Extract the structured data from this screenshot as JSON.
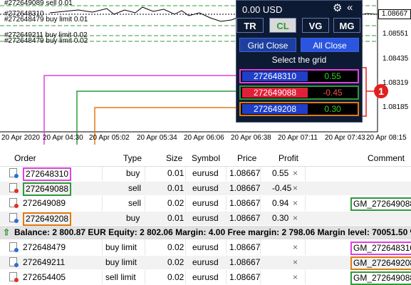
{
  "chart": {
    "current_price": "1.08667",
    "y_ticks": [
      "1.08551",
      "1.08435",
      "1.08319",
      "1.08185"
    ],
    "x_ticks": [
      "20 Apr 2020",
      "20 Apr 04:30",
      "20 Apr 05:02",
      "20 Apr 05:34",
      "20 Apr 06:06",
      "20 Apr 06:38",
      "20 Apr 07:11",
      "20 Apr 07:43",
      "20 Apr 08:15"
    ],
    "line_labels": [
      "#272649089 sell 0.01",
      "#272648479 buy limit 0.01",
      "#272649211 buy limit 0.02",
      "#272648479 buy limit 0.02"
    ],
    "line_label_top": "#272648310"
  },
  "panel": {
    "balance": "0.00 USD",
    "gear_icon": "gear-icon",
    "collapse_icon": "double-chevron-left-icon",
    "tabs": [
      "TR",
      "CL",
      "VG",
      "MG"
    ],
    "active_tab": "CL",
    "buttons": [
      "Grid Close",
      "All Close"
    ],
    "select_label": "Select the grid",
    "grids": [
      {
        "id": "272648310",
        "profit": "0.55",
        "border": "#e040e0",
        "bg": "#1f3fc9",
        "profit_color": "#2fd02f"
      },
      {
        "id": "272649088",
        "profit": "-0.45",
        "border": "#2e9a3a",
        "bg": "#e0203a",
        "profit_color": "#f24848"
      },
      {
        "id": "272649208",
        "profit": "0.30",
        "border": "#e07a10",
        "bg": "#1f3fc9",
        "profit_color": "#2fd02f"
      }
    ]
  },
  "callout": {
    "number": "1",
    "color": "#e0201d"
  },
  "table": {
    "headers": {
      "order": "Order",
      "type": "Type",
      "size": "Size",
      "symbol": "Symbol",
      "price": "Price",
      "profit": "Profit",
      "comment": "Comment"
    },
    "rows": [
      {
        "order": "272648310",
        "type": "buy",
        "size": "0.01",
        "symbol": "eurusd",
        "price": "1.08667",
        "profit": "0.55",
        "comment": "",
        "order_box": "#e040e0",
        "comment_box": "",
        "dot": "#2a6fd6"
      },
      {
        "order": "272649088",
        "type": "sell",
        "size": "0.01",
        "symbol": "eurusd",
        "price": "1.08667",
        "profit": "-0.45",
        "comment": "",
        "order_box": "#2e9a3a",
        "comment_box": "",
        "dot": "#e0301d"
      },
      {
        "order": "272649089",
        "type": "sell",
        "size": "0.02",
        "symbol": "eurusd",
        "price": "1.08667",
        "profit": "0.94",
        "comment": "GM_272649088",
        "order_box": "",
        "comment_box": "#2e9a3a",
        "dot": "#e0301d"
      },
      {
        "order": "272649208",
        "type": "buy",
        "size": "0.01",
        "symbol": "eurusd",
        "price": "1.08667",
        "profit": "0.30",
        "comment": "",
        "order_box": "#e07a10",
        "comment_box": "",
        "dot": "#2a6fd6"
      }
    ],
    "summary": "Balance: 2 800.87 EUR  Equity: 2 802.06  Margin: 4.00  Free margin: 2 798.06  Margin level: 70051.50 %",
    "pending": [
      {
        "order": "272648479",
        "type": "buy limit",
        "size": "0.02",
        "symbol": "eurusd",
        "price": "1.08667",
        "comment": "GM_272648310",
        "comment_box": "#e040e0",
        "dot": "#2a6fd6"
      },
      {
        "order": "272649211",
        "type": "buy limit",
        "size": "0.02",
        "symbol": "eurusd",
        "price": "1.08667",
        "comment": "GM_272649208",
        "comment_box": "#e07a10",
        "dot": "#2a6fd6"
      },
      {
        "order": "272654405",
        "type": "sell limit",
        "size": "0.02",
        "symbol": "eurusd",
        "price": "1.08667",
        "comment": "GM_272649088",
        "comment_box": "#2e9a3a",
        "dot": "#e0301d"
      }
    ]
  }
}
